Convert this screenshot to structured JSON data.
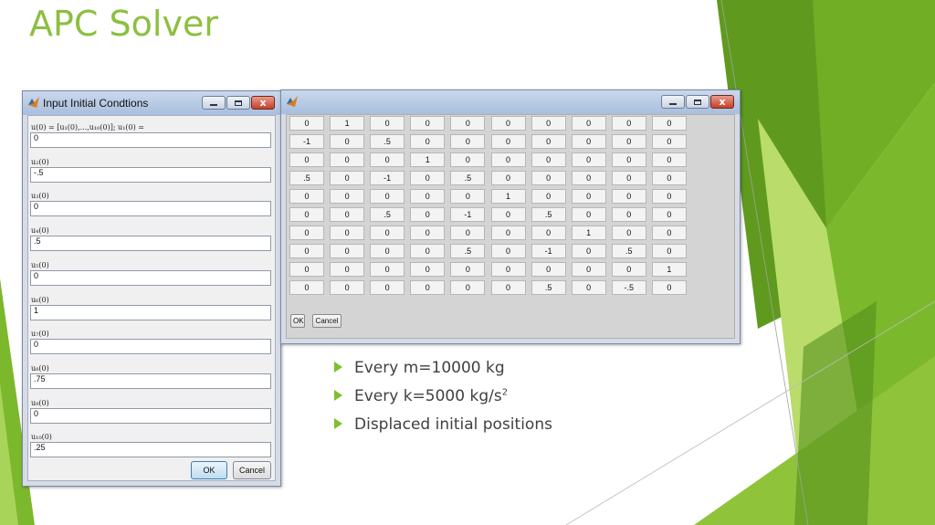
{
  "slide": {
    "title": "APC Solver",
    "bullets": [
      {
        "text": "Every m=10000 kg",
        "sup": ""
      },
      {
        "text": "Every k=5000 kg/s",
        "sup": "2"
      },
      {
        "text": "Displaced initial positions",
        "sup": ""
      }
    ]
  },
  "colors": {
    "accent_green": "#8cbf3f",
    "dark_green": "#5f9a1e",
    "light_green": "#b9dc6a"
  },
  "icons": {
    "app": "matlab-app-icon",
    "minimize": "minimize-icon",
    "maximize": "maximize-icon",
    "close": "close-icon",
    "bullet": "triangle-bullet-icon"
  },
  "input_dialog": {
    "title": "Input Initial Condtions",
    "fields": [
      {
        "label": "u(0) = [u₁(0),...,u₁₀(0)]; u₁(0) =",
        "value": "0"
      },
      {
        "label": "u₂(0)",
        "value": "-.5"
      },
      {
        "label": "u₃(0)",
        "value": "0"
      },
      {
        "label": "u₄(0)",
        "value": ".5"
      },
      {
        "label": "u₅(0)",
        "value": "0"
      },
      {
        "label": "u₆(0)",
        "value": "1"
      },
      {
        "label": "u₇(0)",
        "value": "0"
      },
      {
        "label": "u₈(0)",
        "value": ".75"
      },
      {
        "label": "u₉(0)",
        "value": "0"
      },
      {
        "label": "u₁₀(0)",
        "value": ".25"
      }
    ],
    "ok_label": "OK",
    "cancel_label": "Cancel"
  },
  "matrix_window": {
    "title": "",
    "rows": [
      [
        "0",
        "1",
        "0",
        "0",
        "0",
        "0",
        "0",
        "0",
        "0",
        "0"
      ],
      [
        "-1",
        "0",
        ".5",
        "0",
        "0",
        "0",
        "0",
        "0",
        "0",
        "0"
      ],
      [
        "0",
        "0",
        "0",
        "1",
        "0",
        "0",
        "0",
        "0",
        "0",
        "0"
      ],
      [
        ".5",
        "0",
        "-1",
        "0",
        ".5",
        "0",
        "0",
        "0",
        "0",
        "0"
      ],
      [
        "0",
        "0",
        "0",
        "0",
        "0",
        "1",
        "0",
        "0",
        "0",
        "0"
      ],
      [
        "0",
        "0",
        ".5",
        "0",
        "-1",
        "0",
        ".5",
        "0",
        "0",
        "0"
      ],
      [
        "0",
        "0",
        "0",
        "0",
        "0",
        "0",
        "0",
        "1",
        "0",
        "0"
      ],
      [
        "0",
        "0",
        "0",
        "0",
        ".5",
        "0",
        "-1",
        "0",
        ".5",
        "0"
      ],
      [
        "0",
        "0",
        "0",
        "0",
        "0",
        "0",
        "0",
        "0",
        "0",
        "1"
      ],
      [
        "0",
        "0",
        "0",
        "0",
        "0",
        "0",
        ".5",
        "0",
        "-.5",
        "0"
      ]
    ],
    "ok_label": "OK",
    "cancel_label": "Cancel"
  }
}
